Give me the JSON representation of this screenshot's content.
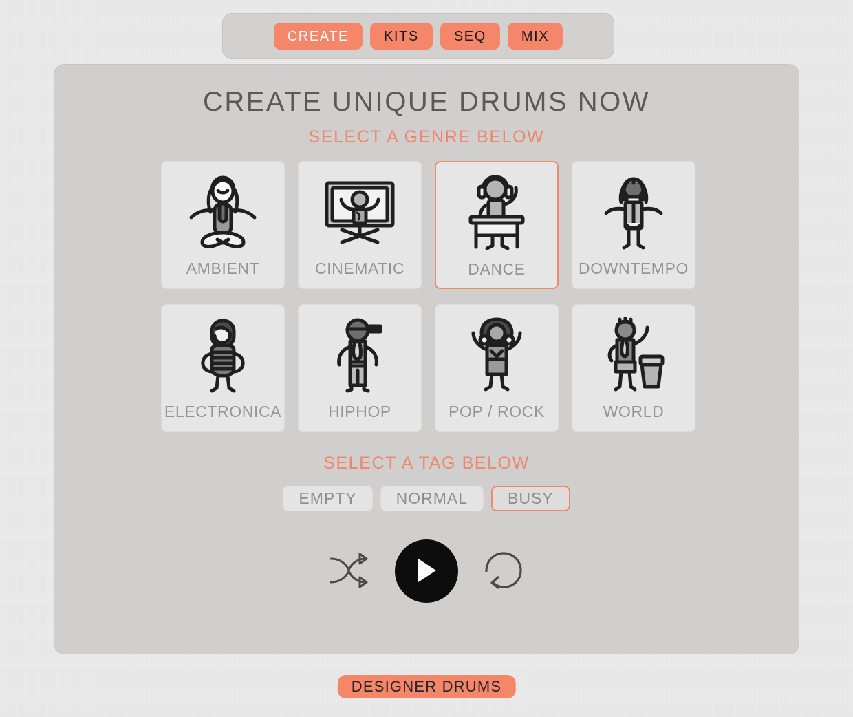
{
  "nav": {
    "items": [
      {
        "label": "CREATE",
        "active": true
      },
      {
        "label": "KITS",
        "active": false
      },
      {
        "label": "SEQ",
        "active": false
      },
      {
        "label": "MIX",
        "active": false
      }
    ]
  },
  "main": {
    "title": "CREATE UNIQUE DRUMS NOW",
    "genre_prompt": "SELECT A GENRE BELOW",
    "tag_prompt": "SELECT A TAG BELOW",
    "genres": [
      {
        "label": "AMBIENT",
        "icon": "meditating-person-icon",
        "selected": false
      },
      {
        "label": "CINEMATIC",
        "icon": "screen-person-icon",
        "selected": false
      },
      {
        "label": "DANCE",
        "icon": "dj-headphones-icon",
        "selected": true
      },
      {
        "label": "DOWNTEMPO",
        "icon": "dreadlocks-person-icon",
        "selected": false
      },
      {
        "label": "ELECTRONICA",
        "icon": "helmet-person-icon",
        "selected": false
      },
      {
        "label": "HIPHOP",
        "icon": "cap-person-icon",
        "selected": false
      },
      {
        "label": "POP / ROCK",
        "icon": "afro-person-icon",
        "selected": false
      },
      {
        "label": "WORLD",
        "icon": "conga-drummer-icon",
        "selected": false
      }
    ],
    "tags": [
      {
        "label": "EMPTY",
        "selected": false
      },
      {
        "label": "NORMAL",
        "selected": false
      },
      {
        "label": "BUSY",
        "selected": true
      }
    ],
    "transport": [
      {
        "name": "shuffle-button",
        "icon": "shuffle-icon"
      },
      {
        "name": "play-button",
        "icon": "play-icon"
      },
      {
        "name": "reset-button",
        "icon": "loop-arrow-icon"
      }
    ]
  },
  "footer": {
    "brand": "DESIGNER DRUMS"
  },
  "colors": {
    "accent": "#f5866a",
    "accent_border": "#ef8a6c",
    "panel": "#d0cfcd",
    "card": "#e6e6e6",
    "background": "#ebeaea",
    "title_text": "#5a5a5a",
    "label_text": "#949494",
    "play_button": "#0d0d0d"
  }
}
